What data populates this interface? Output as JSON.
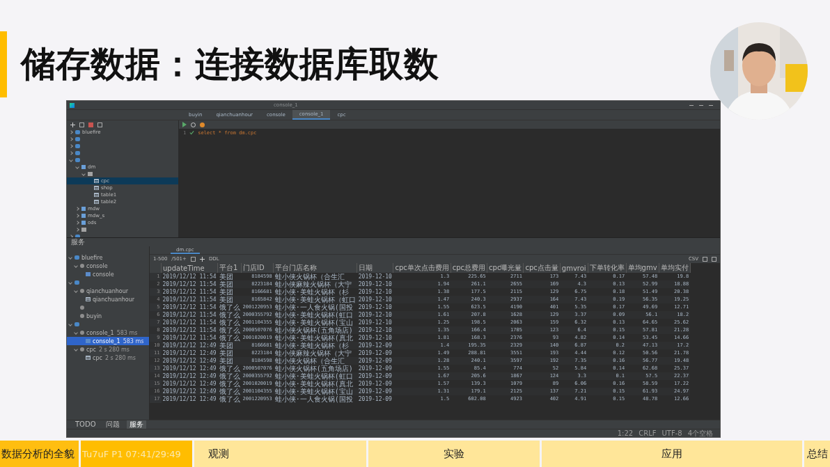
{
  "slide": {
    "title": "储存数据：连接数据库取数"
  },
  "ide": {
    "window_title": "console_1",
    "editor_tabs": [
      {
        "label": "buyin",
        "selected": false
      },
      {
        "label": "qianchuanhour",
        "selected": false
      },
      {
        "label": "console",
        "selected": false
      },
      {
        "label": "console_1",
        "selected": true
      },
      {
        "label": "cpc",
        "selected": false
      }
    ],
    "db_tree": [
      {
        "kind": "source",
        "label": "bluefire",
        "expanded": false,
        "selected": false
      },
      {
        "kind": "source",
        "expanded": false,
        "selected": false
      },
      {
        "kind": "source",
        "expanded": false,
        "selected": false
      },
      {
        "kind": "source",
        "expanded": false,
        "selected": false
      },
      {
        "kind": "source",
        "expanded": true,
        "selected": false,
        "children": [
          {
            "kind": "schema",
            "label": "dm",
            "expanded": true,
            "selected": false,
            "children": [
              {
                "kind": "folder",
                "expanded": true,
                "selected": false,
                "children": [
                  {
                    "kind": "table",
                    "label": "cpc",
                    "expanded": false,
                    "selected": true
                  },
                  {
                    "kind": "table",
                    "label": "shop",
                    "expanded": false,
                    "selected": false
                  },
                  {
                    "kind": "table",
                    "label": "table1",
                    "expanded": false,
                    "selected": false
                  },
                  {
                    "kind": "table",
                    "label": "table2",
                    "expanded": false,
                    "selected": false
                  }
                ]
              }
            ]
          },
          {
            "kind": "schema",
            "label": "mdw",
            "expanded": false,
            "selected": false
          },
          {
            "kind": "schema",
            "label": "mdw_s",
            "expanded": false,
            "selected": false
          },
          {
            "kind": "schema",
            "label": "ods",
            "expanded": false,
            "selected": false
          },
          {
            "kind": "folder",
            "expanded": false,
            "selected": false
          }
        ]
      },
      {
        "kind": "source",
        "expanded": false,
        "selected": false
      }
    ],
    "editor": {
      "line_number": "1",
      "sql": "select * from dm.cpc"
    },
    "services_title": "服务",
    "services_tree": [
      {
        "kind": "source",
        "label": "bluefire",
        "expanded": true,
        "selected": false,
        "children": [
          {
            "kind": "session",
            "label": "console",
            "expanded": true,
            "selected": false,
            "children": [
              {
                "kind": "console",
                "label": "console",
                "selected": false
              }
            ]
          }
        ]
      },
      {
        "kind": "source",
        "expanded": true,
        "selected": false,
        "children": [
          {
            "kind": "session",
            "label": "qianchuanhour",
            "expanded": true,
            "selected": false,
            "children": [
              {
                "kind": "table",
                "label": "qianchuanhour",
                "selected": false
              }
            ]
          },
          {
            "kind": "session",
            "expanded": false,
            "selected": false
          },
          {
            "kind": "session",
            "label": "buyin",
            "expanded": false,
            "selected": false
          }
        ]
      },
      {
        "kind": "source",
        "expanded": true,
        "selected": false,
        "children": [
          {
            "kind": "session",
            "label": "console_1",
            "note": "583 ms",
            "expanded": true,
            "selected": false,
            "children": [
              {
                "kind": "console",
                "label": "console_1",
                "note": "583 ms",
                "selected": true
              }
            ]
          },
          {
            "kind": "session",
            "label": "cpc",
            "note": "2 s 280 ms",
            "expanded": true,
            "selected": false,
            "children": [
              {
                "kind": "table",
                "label": "cpc",
                "note": "2 s 280 ms",
                "selected": false
              }
            ]
          }
        ]
      }
    ],
    "result_tab": "dm.cpc",
    "paging": {
      "range": "1-500",
      "total": "/501+"
    },
    "toolbar_texts": [
      "DDL"
    ],
    "export": "CSV",
    "columns": [
      {
        "label": "updateTime",
        "kind": "time"
      },
      {
        "label": "平台1",
        "kind": "text"
      },
      {
        "label": "门店ID",
        "kind": "number"
      },
      {
        "label": "平台门店名称",
        "kind": "text"
      },
      {
        "label": "日期",
        "kind": "time"
      },
      {
        "label": "cpc单次点击费用",
        "kind": "number"
      },
      {
        "label": "cpc总费用",
        "kind": "number"
      },
      {
        "label": "cpc曝光量",
        "kind": "number"
      },
      {
        "label": "cpc点击量",
        "kind": "number"
      },
      {
        "label": "gmvroi",
        "kind": "number"
      },
      {
        "label": "下单转化率",
        "kind": "number"
      },
      {
        "label": "单均gmv",
        "kind": "number"
      },
      {
        "label": "单均实付",
        "kind": "number"
      }
    ],
    "row_numbers": [
      "1",
      "2",
      "3",
      "4",
      "5",
      "6",
      "7",
      "8",
      "9",
      "10",
      "11",
      "12",
      "13",
      "14",
      "15",
      "16",
      "17"
    ],
    "rows": [
      [
        "2019/12/12 11:54",
        "美团",
        "8184598",
        "蛙小侠火锅杯（合生汇",
        "2019-12-10",
        "1.3",
        "225.65",
        "2711",
        "173",
        "7.43",
        "0.17",
        "57.48",
        "19.8"
      ],
      [
        "2019/12/12 11:54",
        "美团",
        "8223184",
        "蛙小侠麻辣火锅杯（大宁",
        "2019-12-10",
        "1.94",
        "261.1",
        "2655",
        "169",
        "4.3",
        "0.13",
        "52.99",
        "18.88"
      ],
      [
        "2019/12/12 11:54",
        "美团",
        "8166681",
        "蛙小侠·美蛙火锅杯（杉",
        "2019-12-10",
        "1.38",
        "177.5",
        "2115",
        "129",
        "6.75",
        "0.18",
        "51.49",
        "20.38"
      ],
      [
        "2019/12/12 11:54",
        "美团",
        "8165842",
        "蛙小侠·美蛙火锅杯（虹口",
        "2019-12-10",
        "1.47",
        "240.3",
        "2937",
        "164",
        "7.43",
        "0.19",
        "56.35",
        "19.25"
      ],
      [
        "2019/12/12 11:54",
        "饿了么",
        "2001220953",
        "蛙小侠·一人食火锅(国投",
        "2019-12-10",
        "1.55",
        "623.5",
        "4190",
        "401",
        "5.35",
        "0.17",
        "49.69",
        "12.71"
      ],
      [
        "2019/12/12 11:54",
        "饿了么",
        "2000355792",
        "蛙小侠·美蛙火锅杯(虹口",
        "2019-12-10",
        "1.61",
        "207.8",
        "1628",
        "129",
        "3.37",
        "0.09",
        "56.1",
        "18.2"
      ],
      [
        "2019/12/12 11:54",
        "饿了么",
        "2001104355",
        "蛙小侠·美蛙火锅杯(宝山",
        "2019-12-10",
        "1.25",
        "198.5",
        "2063",
        "159",
        "6.32",
        "0.13",
        "64.65",
        "25.62"
      ],
      [
        "2019/12/12 11:54",
        "饿了么",
        "2000507076",
        "蛙小侠火锅杯(五角场店)",
        "2019-12-10",
        "1.35",
        "166.4",
        "1705",
        "123",
        "6.4",
        "0.15",
        "57.81",
        "21.28"
      ],
      [
        "2019/12/12 11:54",
        "饿了么",
        "2001020019",
        "蛙小侠·美蛙火锅杯(真北",
        "2019-12-10",
        "1.81",
        "168.3",
        "2376",
        "93",
        "4.82",
        "0.14",
        "53.45",
        "14.66"
      ],
      [
        "2019/12/12 12:49",
        "美团",
        "8166681",
        "蛙小侠·美蛙火锅杯（杉",
        "2019-12-09",
        "1.4",
        "195.35",
        "2329",
        "140",
        "6.87",
        "0.2",
        "47.13",
        "17.2"
      ],
      [
        "2019/12/12 12:49",
        "美团",
        "8223184",
        "蛙小侠麻辣火锅杯（大宁",
        "2019-12-09",
        "1.49",
        "288.81",
        "3551",
        "193",
        "4.44",
        "0.12",
        "50.56",
        "21.78"
      ],
      [
        "2019/12/12 12:49",
        "美团",
        "8184598",
        "蛙小侠火锅杯（合生汇",
        "2019-12-09",
        "1.28",
        "240.1",
        "3597",
        "192",
        "7.35",
        "0.16",
        "56.77",
        "19.48"
      ],
      [
        "2019/12/12 12:49",
        "饿了么",
        "2000507076",
        "蛙小侠火锅杯(五角场店)",
        "2019-12-09",
        "1.55",
        "85.4",
        "774",
        "52",
        "5.84",
        "0.14",
        "62.68",
        "25.37"
      ],
      [
        "2019/12/12 12:49",
        "饿了么",
        "2000355792",
        "蛙小侠·美蛙火锅杯(虹口",
        "2019-12-09",
        "1.67",
        "205.6",
        "1867",
        "124",
        "3.3",
        "0.1",
        "57.5",
        "22.37"
      ],
      [
        "2019/12/12 12:49",
        "饿了么",
        "2001020019",
        "蛙小侠·美蛙火锅杯(真北",
        "2019-12-09",
        "1.57",
        "139.3",
        "1079",
        "89",
        "6.06",
        "0.16",
        "58.59",
        "17.22"
      ],
      [
        "2019/12/12 12:49",
        "饿了么",
        "2001104355",
        "蛙小侠·美蛙火锅杯(宝山",
        "2019-12-09",
        "1.31",
        "179.1",
        "2125",
        "137",
        "7.21",
        "0.15",
        "61.93",
        "24.97"
      ],
      [
        "2019/12/12 12:49",
        "饿了么",
        "2001220953",
        "蛙小侠·一人食火锅(国投",
        "2019-12-09",
        "1.5",
        "602.08",
        "4923",
        "402",
        "4.91",
        "0.15",
        "48.78",
        "12.66"
      ]
    ],
    "bottom_tabs": [
      {
        "label": "TODO",
        "selected": false
      },
      {
        "label": "问题",
        "selected": false
      },
      {
        "label": "服务",
        "selected": true
      }
    ],
    "status_right": [
      "1:22",
      "CRLF",
      "UTF-8",
      "4个空格"
    ]
  },
  "nav": {
    "chapters": [
      {
        "label": "数据分析的全貌",
        "selected": true
      },
      {
        "label": "观测",
        "selected": false
      },
      {
        "label": "实验",
        "selected": false
      },
      {
        "label": "应用",
        "selected": false
      },
      {
        "label": "总结",
        "selected": false
      }
    ],
    "progress_text": "Tu7uF P1 07:41/29:49"
  }
}
